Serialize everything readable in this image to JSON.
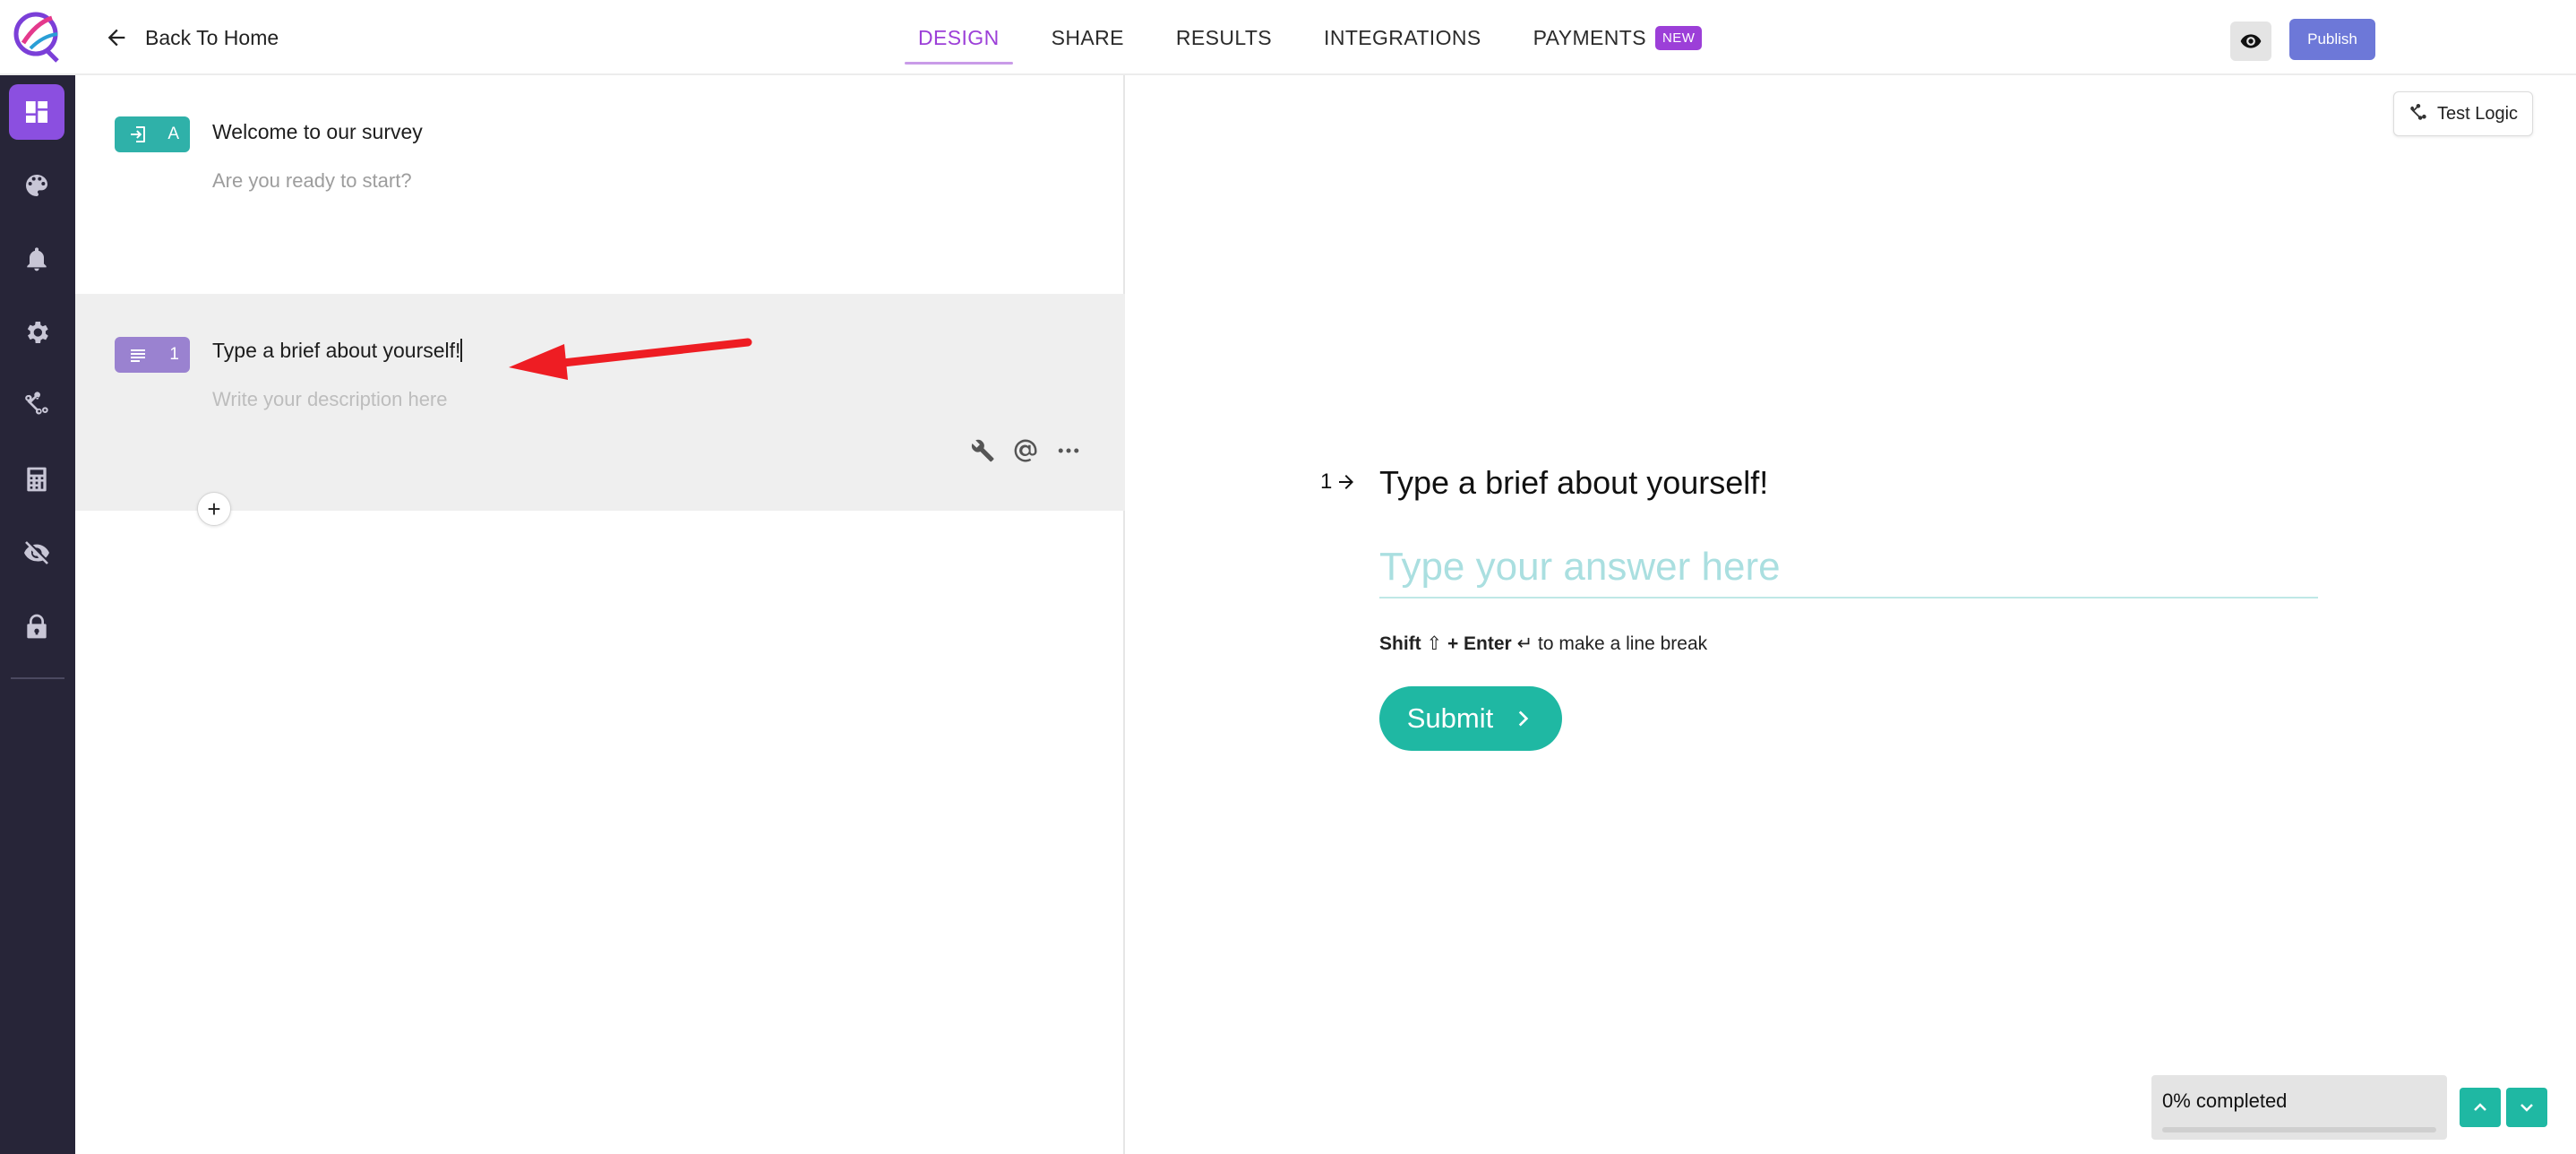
{
  "app": {
    "back_label": "Back To Home"
  },
  "nav": {
    "tabs": [
      {
        "label": "DESIGN",
        "active": true
      },
      {
        "label": "SHARE",
        "active": false
      },
      {
        "label": "RESULTS",
        "active": false
      },
      {
        "label": "INTEGRATIONS",
        "active": false
      },
      {
        "label": "PAYMENTS",
        "active": false,
        "badge": "NEW"
      }
    ],
    "publish_label": "Publish"
  },
  "sidebar": {
    "items": [
      {
        "icon": "dashboard-icon",
        "active": true
      },
      {
        "icon": "palette-icon"
      },
      {
        "icon": "bell-icon"
      },
      {
        "icon": "gear-icon"
      },
      {
        "icon": "logic-flow-icon"
      },
      {
        "icon": "calculator-icon"
      },
      {
        "icon": "eye-off-icon"
      },
      {
        "icon": "lock-icon"
      }
    ]
  },
  "editor": {
    "welcome": {
      "tag_letter": "A",
      "title": "Welcome to our survey",
      "description": "Are you ready to start?"
    },
    "question": {
      "tag_number": "1",
      "title": "Type a brief about yourself!",
      "description_placeholder": "Write your description here"
    },
    "add_label": "+"
  },
  "preview": {
    "test_logic_label": "Test Logic",
    "question_number": "1",
    "question_title": "Type a brief about yourself!",
    "answer_placeholder": "Type your answer here",
    "hint": {
      "shift": "Shift",
      "shift_symbol": "⇧",
      "plus_enter": "+ Enter",
      "enter_symbol": "↵",
      "rest": "to make a line break"
    },
    "submit_label": "Submit",
    "progress": {
      "label": "0% completed",
      "percent": 0
    }
  },
  "colors": {
    "accent_purple": "#9c3fd8",
    "teal": "#1fb8a3",
    "welcome_tag": "#2fb1a9",
    "question_tag": "#9a82d0",
    "sidebar_bg": "#272538",
    "publish": "#6d78d8"
  }
}
